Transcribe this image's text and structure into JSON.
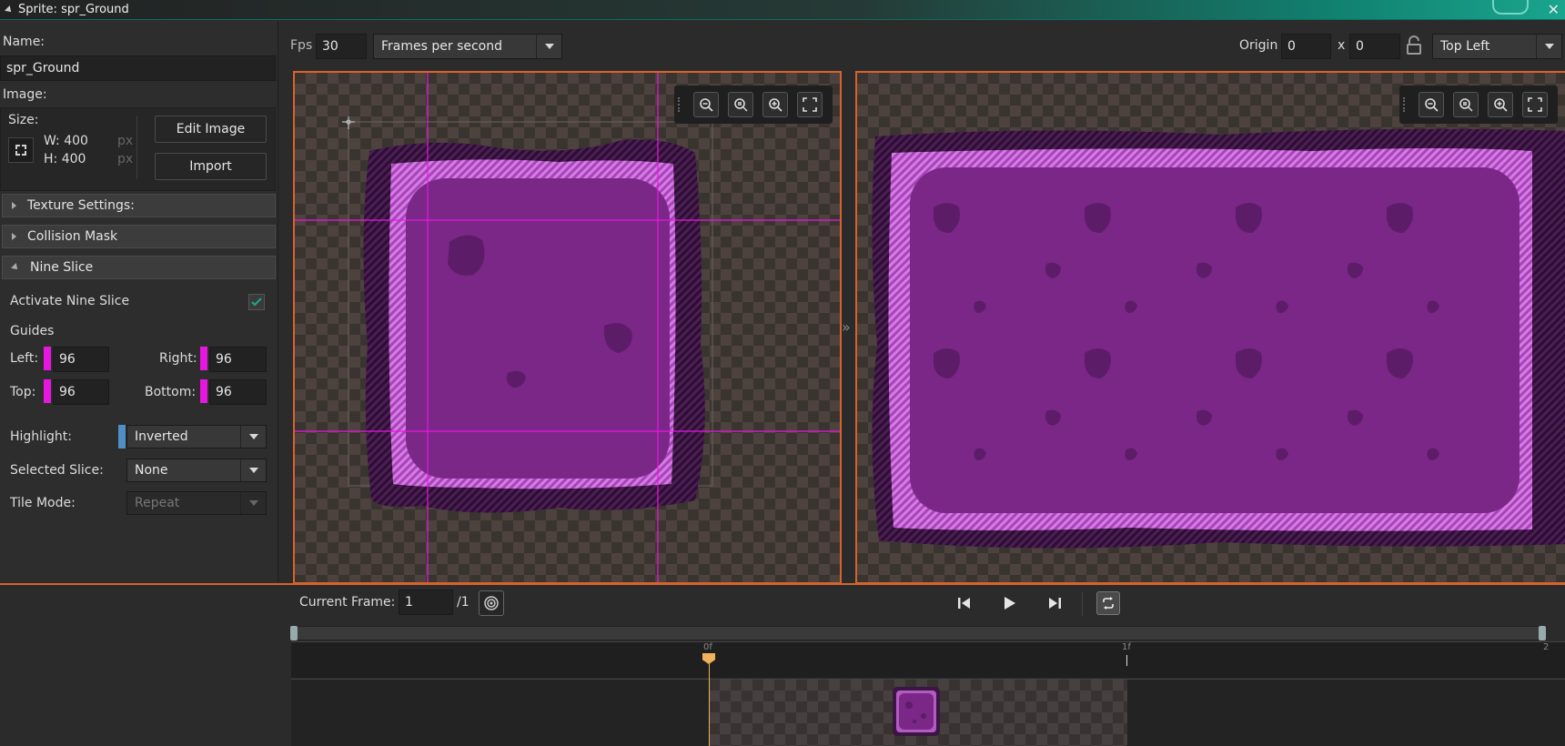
{
  "window": {
    "title": "Sprite: spr_Ground"
  },
  "props": {
    "name_label": "Name:",
    "name_value": "spr_Ground",
    "image_label": "Image:",
    "size_label": "Size:",
    "width": "W: 400",
    "height": "H: 400",
    "unit": "px",
    "edit_image_label": "Edit Image",
    "import_label": "Import"
  },
  "sections": {
    "texture": "Texture Settings:",
    "collision": "Collision Mask",
    "nine_slice": "Nine Slice"
  },
  "nine_slice": {
    "activate_label": "Activate Nine Slice",
    "activated": true,
    "guides_label": "Guides",
    "left_label": "Left:",
    "left_value": "96",
    "right_label": "Right:",
    "right_value": "96",
    "top_label": "Top:",
    "top_value": "96",
    "bottom_label": "Bottom:",
    "bottom_value": "96",
    "highlight_label": "Highlight:",
    "highlight_value": "Inverted",
    "selected_label": "Selected Slice:",
    "selected_value": "None",
    "tilemode_label": "Tile Mode:",
    "tilemode_value": "Repeat",
    "guide_color": "#e817e0"
  },
  "toolbar": {
    "fps_label": "Fps",
    "fps_value": "30",
    "fps_mode": "Frames per second",
    "origin_label": "Origin",
    "origin_x": "0",
    "origin_sep": "x",
    "origin_y": "0",
    "origin_preset": "Top Left"
  },
  "playback": {
    "current_frame_label": "Current Frame:",
    "current_frame_value": "1",
    "frame_total": "/1",
    "ruler_marks": [
      "0f",
      "1f",
      "2"
    ]
  },
  "colors": {
    "accent": "#d7632a",
    "sprite_fill": "#7a2787",
    "sprite_border": "#3b1643",
    "sprite_hatch": "#c55bd4",
    "playhead": "#f2b25c"
  }
}
